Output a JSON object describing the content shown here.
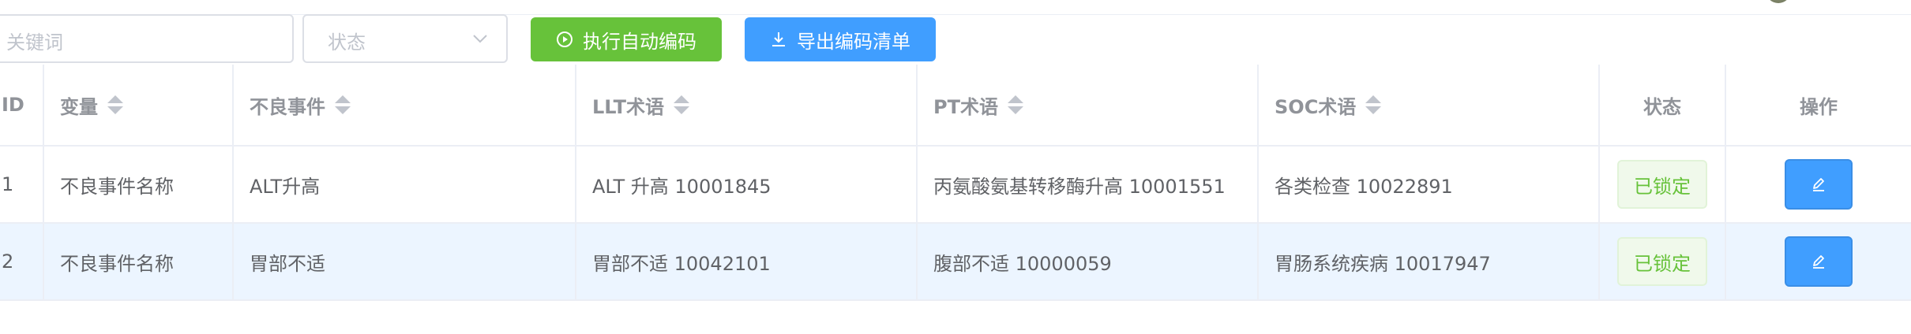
{
  "toolbar": {
    "keyword_placeholder": "关键词",
    "status_placeholder": "状态",
    "auto_code_label": "执行自动编码",
    "export_label": "导出编码清单"
  },
  "table": {
    "headers": {
      "id": "ID",
      "variable": "变量",
      "adverse_event": "不良事件",
      "llt": "LLT术语",
      "pt": "PT术语",
      "soc": "SOC术语",
      "status": "状态",
      "actions": "操作"
    },
    "rows": [
      {
        "id": "1",
        "variable": "不良事件名称",
        "adverse_event": "ALT升高",
        "llt": "ALT 升高 10001845",
        "pt": "丙氨酸氨基转移酶升高 10001551",
        "soc": "各类检查 10022891",
        "status": "已锁定"
      },
      {
        "id": "2",
        "variable": "不良事件名称",
        "adverse_event": "胃部不适",
        "llt": "胃部不适 10042101",
        "pt": "腹部不适 10000059",
        "soc": "胃肠系统疾病 10017947",
        "status": "已锁定"
      }
    ]
  },
  "colors": {
    "success": "#67c23a",
    "primary": "#409eff",
    "row_highlight": "#ecf5ff",
    "border": "#ebeef5"
  },
  "icons": {
    "auto_code": "play-circle-icon",
    "export": "download-icon",
    "status_select": "chevron-down-icon",
    "edit": "edit-pencil-icon",
    "sort": "sort-caret-icon"
  }
}
